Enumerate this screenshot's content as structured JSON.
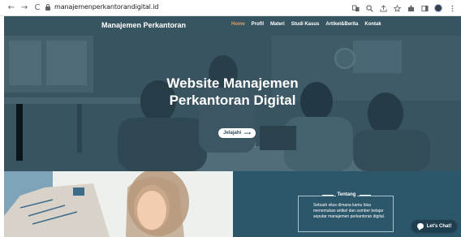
{
  "browser": {
    "url": "manajemenperkantorandigital.id",
    "back_glyph": "←",
    "forward_glyph": "→",
    "reload_glyph": "C",
    "toolbar_icons": [
      "translate-icon",
      "zoom-icon",
      "share-icon",
      "bookmark-star-icon",
      "extensions-icon",
      "sidebar-icon",
      "profile-avatar-icon",
      "menu-kebab-icon"
    ]
  },
  "header": {
    "brand": "Manajemen Perkantoran",
    "menu": [
      {
        "label": "Home",
        "active": true
      },
      {
        "label": "Profil",
        "active": false
      },
      {
        "label": "Materi",
        "active": false
      },
      {
        "label": "Studi Kasus",
        "active": false
      },
      {
        "label": "Artikel&Berita",
        "active": false
      },
      {
        "label": "Kontak",
        "active": false
      }
    ]
  },
  "hero": {
    "title_line1": "Website Manajemen",
    "title_line2": "Perkantoran Digital",
    "cta_label": "Jelajahi",
    "cta_arrow": "⟶"
  },
  "about": {
    "heading": "Tentang",
    "text": "Sebuah situs dimana kamu bisa menemukan artikel dan sumber belajar seputar manajemen perkantoran digital."
  },
  "chat": {
    "label": "Let's Chat!"
  },
  "colors": {
    "accent": "#d9a066",
    "about_bg": "#2c5669",
    "chat_bg": "#1f3f4f"
  }
}
